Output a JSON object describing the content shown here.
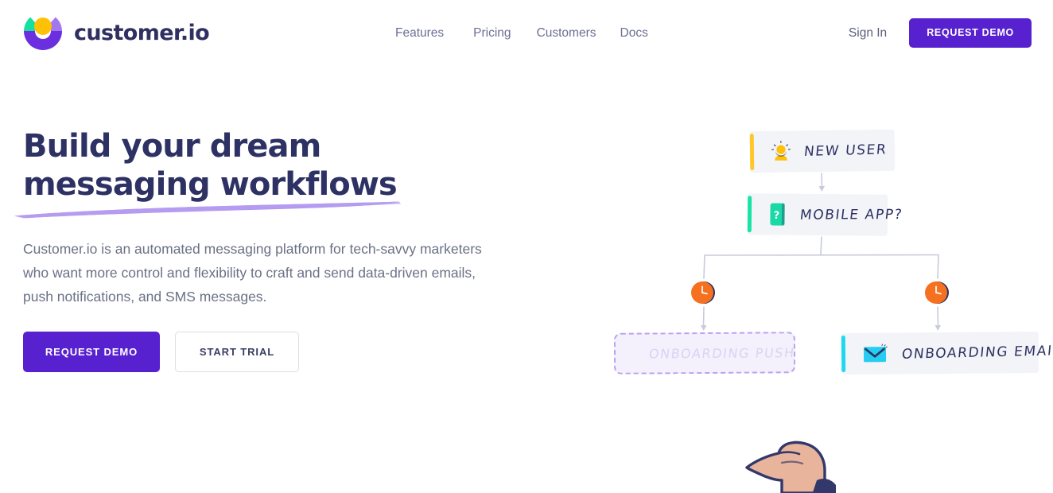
{
  "header": {
    "logo": {
      "icon_name": "customer-io-logo-mark",
      "wordmark": "customer.io",
      "colors": {
        "sun": "#FFC107",
        "teal": "#17DFA0",
        "purple": "#6B2FE0",
        "lilac": "#A277F0",
        "wordmark": "#2F3061"
      }
    },
    "nav": [
      {
        "label": "Features"
      },
      {
        "label": "Pricing"
      },
      {
        "label": "Customers"
      },
      {
        "label": "Docs"
      }
    ],
    "signin_label": "Sign In",
    "demo_button_label": "REQUEST DEMO"
  },
  "hero": {
    "headline_line1": "Build your dream",
    "headline_line2": "messaging workflows",
    "underline_color": "#A78BEE",
    "subcopy": "Customer.io is an automated messaging platform for tech-savvy marketers who want more control and flexibility to craft and send data-driven emails, push notifications, and SMS messages.",
    "primary_cta": "REQUEST DEMO",
    "secondary_cta": "START TRIAL"
  },
  "workflow": {
    "nodes": [
      {
        "id": "new-user",
        "label": "NEW USER",
        "icon_name": "person-sparkle-icon",
        "accent_color": "#FFC72C",
        "state": "active"
      },
      {
        "id": "mobile-app",
        "label": "MOBILE APP?",
        "icon_name": "mobile-phone-question-icon",
        "accent_color": "#19E3A5",
        "state": "active"
      },
      {
        "id": "onboarding-push",
        "label": "ONBOARDING PUSH",
        "icon_name": "push-notification-icon",
        "accent_color": "#B9A3EE",
        "state": "placeholder"
      },
      {
        "id": "onboarding-email",
        "label": "ONBOARDING EMAIL",
        "icon_name": "envelope-icon",
        "accent_color": "#1ED8F0",
        "state": "active"
      }
    ],
    "delays": [
      {
        "id": "delay-left",
        "icon_name": "clock-icon",
        "color": "#F5711F"
      },
      {
        "id": "delay-right",
        "icon_name": "clock-icon",
        "color": "#F5711F"
      }
    ],
    "cursor": {
      "icon_name": "pointing-hand-icon",
      "skin_color": "#E8B49C",
      "outline_color": "#33386B"
    },
    "connector_color": "#C9CBDC"
  },
  "theme": {
    "brand_purple": "#5821D0",
    "ink_navy": "#2D3163",
    "body_gray": "#6B7186",
    "card_bg": "#F3F4F7",
    "page_bg": "#FFFFFF"
  }
}
